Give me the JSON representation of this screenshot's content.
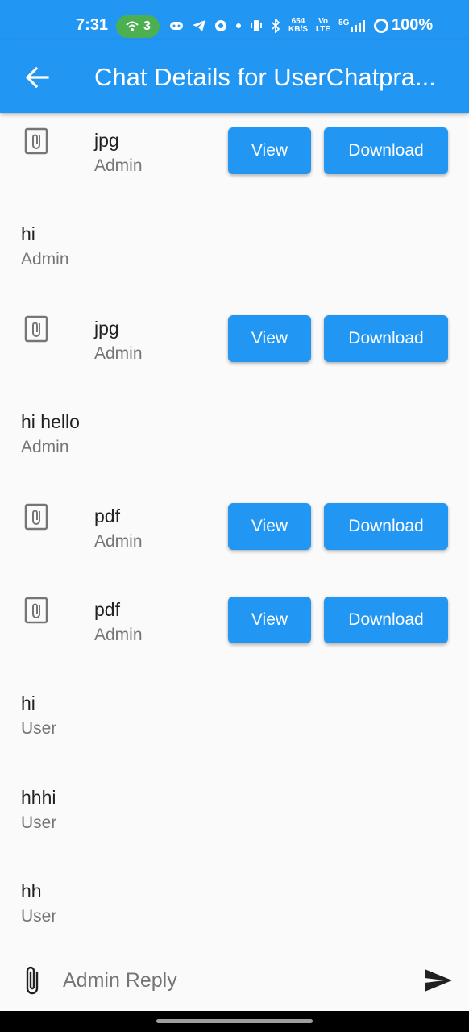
{
  "status_bar": {
    "time": "7:31",
    "hotspot_count": "3",
    "speed_value": "654",
    "speed_unit": "KB/S",
    "volte_top": "Vo",
    "volte_bottom": "LTE",
    "network": "5G",
    "battery": "100%",
    "icons": [
      "hotspot-icon",
      "discord-icon",
      "telegram-icon",
      "browser-icon",
      "dot-icon",
      "vibrate-icon",
      "bluetooth-icon",
      "signal-icon",
      "battery-ring-icon"
    ]
  },
  "app_bar": {
    "back_icon": "arrow-left-icon",
    "title": "Chat Details for UserChatpra..."
  },
  "messages": [
    {
      "kind": "file",
      "type": "jpg",
      "sender": "Admin",
      "view_label": "View",
      "download_label": "Download"
    },
    {
      "kind": "text",
      "text": "hi",
      "sender": "Admin"
    },
    {
      "kind": "file",
      "type": "jpg",
      "sender": "Admin",
      "view_label": "View",
      "download_label": "Download"
    },
    {
      "kind": "text",
      "text": "hi hello",
      "sender": "Admin"
    },
    {
      "kind": "file",
      "type": "pdf",
      "sender": "Admin",
      "view_label": "View",
      "download_label": "Download"
    },
    {
      "kind": "file",
      "type": "pdf",
      "sender": "Admin",
      "view_label": "View",
      "download_label": "Download"
    },
    {
      "kind": "text",
      "text": "hi",
      "sender": "User"
    },
    {
      "kind": "text",
      "text": "hhhi",
      "sender": "User"
    },
    {
      "kind": "text",
      "text": "hh",
      "sender": "User"
    }
  ],
  "composer": {
    "placeholder": "Admin Reply",
    "value": "",
    "attach_icon": "paperclip-icon",
    "send_icon": "send-icon"
  },
  "colors": {
    "primary": "#2196f3",
    "hotspot_green": "#4caf50",
    "text": "#212121",
    "secondary_text": "#757575",
    "background": "#fafafa"
  }
}
